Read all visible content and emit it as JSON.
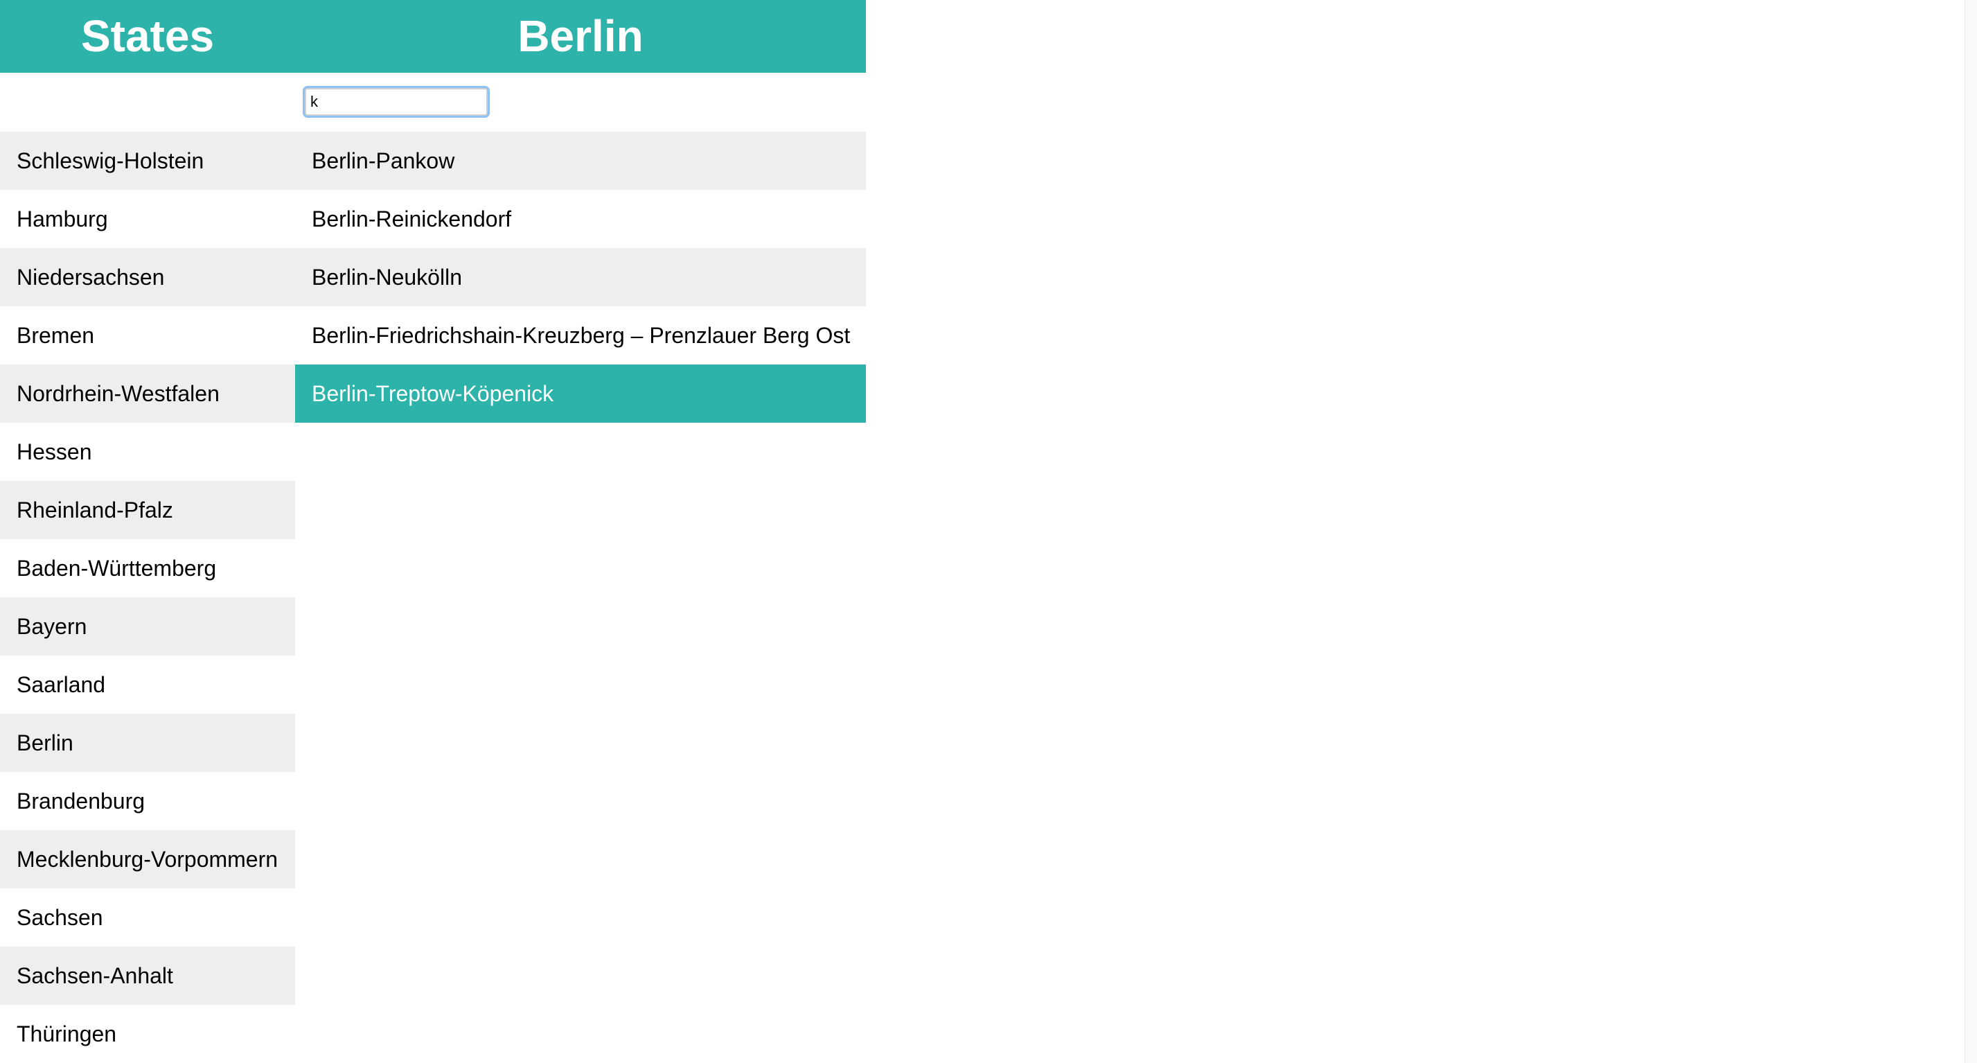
{
  "header": {
    "states_title": "States",
    "districts_title": "Berlin"
  },
  "filter": {
    "value": "k",
    "placeholder": ""
  },
  "states": [
    "Schleswig-Holstein",
    "Hamburg",
    "Niedersachsen",
    "Bremen",
    "Nordrhein-Westfalen",
    "Hessen",
    "Rheinland-Pfalz",
    "Baden-Württemberg",
    "Bayern",
    "Saarland",
    "Berlin",
    "Brandenburg",
    "Mecklenburg-Vorpommern",
    "Sachsen",
    "Sachsen-Anhalt",
    "Thüringen"
  ],
  "districts": [
    "Berlin-Pankow",
    "Berlin-Reinickendorf",
    "Berlin-Neukölln",
    "Berlin-Friedrichshain-Kreuzberg – Prenzlauer Berg Ost",
    "Berlin-Treptow-Köpenick"
  ],
  "selected_district": "Berlin-Treptow-Köpenick",
  "colors": {
    "accent": "#2db3a9",
    "row_alt": "#eeeeee",
    "row": "#ffffff",
    "text": "#000000",
    "focus_ring": "#8ec1f5"
  }
}
